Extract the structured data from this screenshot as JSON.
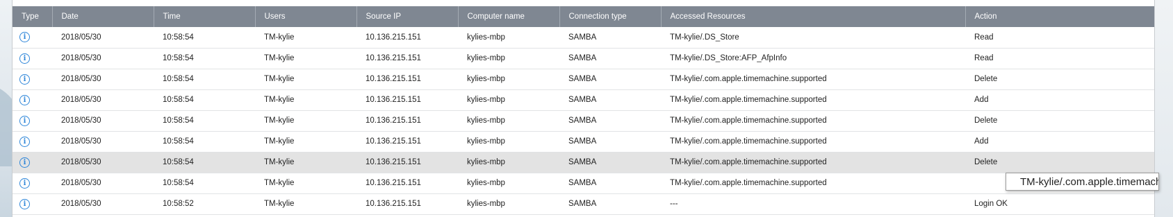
{
  "columns": [
    "Type",
    "Date",
    "Time",
    "Users",
    "Source IP",
    "Computer name",
    "Connection type",
    "Accessed Resources",
    "Action"
  ],
  "rows": [
    {
      "type_icon": "info-icon",
      "date": "2018/05/30",
      "time": "10:58:54",
      "user": "TM-kylie",
      "source_ip": "10.136.215.151",
      "computer": "kylies-mbp",
      "connection": "SAMBA",
      "resource": "TM-kylie/.DS_Store",
      "action": "Read",
      "selected": false
    },
    {
      "type_icon": "info-icon",
      "date": "2018/05/30",
      "time": "10:58:54",
      "user": "TM-kylie",
      "source_ip": "10.136.215.151",
      "computer": "kylies-mbp",
      "connection": "SAMBA",
      "resource": "TM-kylie/.DS_Store:AFP_AfpInfo",
      "action": "Read",
      "selected": false
    },
    {
      "type_icon": "info-icon",
      "date": "2018/05/30",
      "time": "10:58:54",
      "user": "TM-kylie",
      "source_ip": "10.136.215.151",
      "computer": "kylies-mbp",
      "connection": "SAMBA",
      "resource": "TM-kylie/.com.apple.timemachine.supported",
      "action": "Delete",
      "selected": false
    },
    {
      "type_icon": "info-icon",
      "date": "2018/05/30",
      "time": "10:58:54",
      "user": "TM-kylie",
      "source_ip": "10.136.215.151",
      "computer": "kylies-mbp",
      "connection": "SAMBA",
      "resource": "TM-kylie/.com.apple.timemachine.supported",
      "action": "Add",
      "selected": false
    },
    {
      "type_icon": "info-icon",
      "date": "2018/05/30",
      "time": "10:58:54",
      "user": "TM-kylie",
      "source_ip": "10.136.215.151",
      "computer": "kylies-mbp",
      "connection": "SAMBA",
      "resource": "TM-kylie/.com.apple.timemachine.supported",
      "action": "Delete",
      "selected": false
    },
    {
      "type_icon": "info-icon",
      "date": "2018/05/30",
      "time": "10:58:54",
      "user": "TM-kylie",
      "source_ip": "10.136.215.151",
      "computer": "kylies-mbp",
      "connection": "SAMBA",
      "resource": "TM-kylie/.com.apple.timemachine.supported",
      "action": "Add",
      "selected": false
    },
    {
      "type_icon": "info-icon",
      "date": "2018/05/30",
      "time": "10:58:54",
      "user": "TM-kylie",
      "source_ip": "10.136.215.151",
      "computer": "kylies-mbp",
      "connection": "SAMBA",
      "resource": "TM-kylie/.com.apple.timemachine.supported",
      "action": "Delete",
      "selected": true
    },
    {
      "type_icon": "info-icon",
      "date": "2018/05/30",
      "time": "10:58:54",
      "user": "TM-kylie",
      "source_ip": "10.136.215.151",
      "computer": "kylies-mbp",
      "connection": "SAMBA",
      "resource": "TM-kylie/.com.apple.timemachine.supported",
      "action": "",
      "selected": false
    },
    {
      "type_icon": "info-icon",
      "date": "2018/05/30",
      "time": "10:58:52",
      "user": "TM-kylie",
      "source_ip": "10.136.215.151",
      "computer": "kylies-mbp",
      "connection": "SAMBA",
      "resource": "---",
      "action": "Login OK",
      "selected": false
    }
  ],
  "tooltip": "TM-kylie/.com.apple.timemachine.supported",
  "colors": {
    "header_bg": "#7f8792",
    "header_text": "#ffffff",
    "selected_row": "#e3e3e3",
    "info_icon": "#2e86d9"
  }
}
